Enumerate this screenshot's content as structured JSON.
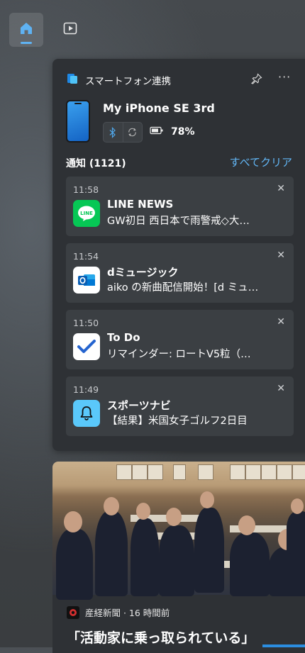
{
  "topnav": {
    "home_icon": "home-icon",
    "video_icon": "play-icon"
  },
  "phone_link": {
    "title": "スマートフォン連携",
    "device_name": "My iPhone SE 3rd",
    "battery": "78%",
    "notifications_label": "通知",
    "notifications_count": "(1121)",
    "clear_all": "すべてクリア",
    "notifications": [
      {
        "time": "11:58",
        "app": "LINE NEWS",
        "body": "GW初日 西日本で雨警戒◇大…",
        "icon": "line-icon",
        "color": "#06C755"
      },
      {
        "time": "11:54",
        "app": "dミュージック",
        "body": "aiko の新曲配信開始！[d ミュ…",
        "icon": "outlook-icon",
        "color": "#0a6ed1"
      },
      {
        "time": "11:50",
        "app": "To Do",
        "body": "リマインダー: ロートV5粒（…",
        "icon": "todo-icon",
        "color": "#2564cf"
      },
      {
        "time": "11:49",
        "app": "スポーツナビ",
        "body": "【結果】米国女子ゴルフ2日目",
        "icon": "bell-icon",
        "color": "#5ac8fa"
      }
    ]
  },
  "news": {
    "source": "産経新聞 · 16 時間前",
    "headline": "「活動家に乗っ取られている」"
  },
  "colors": {
    "accent": "#62b6f5",
    "panel": "#2e3135",
    "card": "#3b3f43"
  }
}
